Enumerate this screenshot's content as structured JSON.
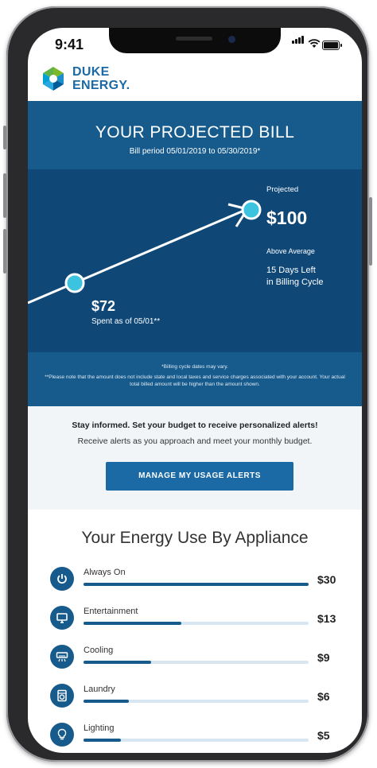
{
  "status_bar": {
    "time": "9:41"
  },
  "brand": {
    "line1": "DUKE",
    "line2": "ENERGY."
  },
  "bill": {
    "title": "YOUR PROJECTED BILL",
    "period": "Bill period 05/01/2019 to 05/30/2019*",
    "projected_label": "Projected",
    "projected_value": "$100",
    "above_average": "Above Average",
    "days_left_line1": "15 Days Left",
    "days_left_line2": "in Billing Cycle",
    "spent_value": "$72",
    "spent_label": "Spent as of 05/01**",
    "note1": "*Billing cycle dates may vary.",
    "note2": "**Please note that the amount does not include state and local taxes and service charges associated with your account. Your actual total billed amount will be higher than the amount shown."
  },
  "alerts": {
    "headline": "Stay informed. Set your budget to receive personalized alerts!",
    "subtext": "Receive alerts as you approach and meet your monthly budget.",
    "button_label": "MANAGE MY USAGE ALERTS"
  },
  "appliances": {
    "title": "Your Energy Use By Appliance",
    "items": [
      {
        "name": "Always On",
        "amount": "$30",
        "value": 30,
        "icon": "power-icon"
      },
      {
        "name": "Entertainment",
        "amount": "$13",
        "value": 13,
        "icon": "tv-icon"
      },
      {
        "name": "Cooling",
        "amount": "$9",
        "value": 9,
        "icon": "ac-icon"
      },
      {
        "name": "Laundry",
        "amount": "$6",
        "value": 6,
        "icon": "washer-icon"
      },
      {
        "name": "Lighting",
        "amount": "$5",
        "value": 5,
        "icon": "bulb-icon"
      }
    ]
  },
  "colors": {
    "primary": "#175b8d",
    "dark": "#0f4877",
    "accent": "#3cc3df",
    "button": "#1b6aa5",
    "logo_green": "#7ab929"
  }
}
